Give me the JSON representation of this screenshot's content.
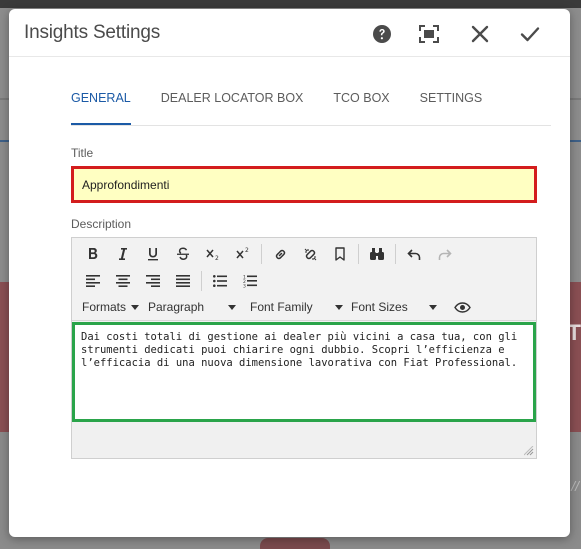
{
  "background": {
    "partial_letter": "T",
    "partial_text": "//"
  },
  "dialog": {
    "title": "Insights Settings",
    "header_buttons": {
      "help_icon": "question-circle-icon",
      "fullscreen_icon": "fullscreen-icon",
      "close_icon": "close-icon",
      "done_icon": "check-icon"
    },
    "tabs": [
      {
        "label": "GENERAL",
        "active": true
      },
      {
        "label": "DEALER LOCATOR BOX",
        "active": false
      },
      {
        "label": "TCO BOX",
        "active": false
      },
      {
        "label": "SETTINGS",
        "active": false
      }
    ],
    "title_field": {
      "label": "Title",
      "value": "Approfondimenti"
    },
    "description_field": {
      "label": "Description",
      "toolbar": {
        "formats_label": "Formats",
        "paragraph_label": "Paragraph",
        "font_family_label": "Font Family",
        "font_sizes_label": "Font Sizes"
      },
      "content": "Dai costi totali di gestione ai dealer più vicini a casa tua, con gli strumenti dedicati puoi chiarire ogni dubbio. Scopri l’efficienza e l’efficacia di una nuova dimensione lavorativa con Fiat Professional."
    }
  },
  "colors": {
    "accent": "#1b5aa6",
    "error_border": "#d31d1d",
    "focus_border": "#2aa44a",
    "input_highlight": "#ffffc2"
  }
}
